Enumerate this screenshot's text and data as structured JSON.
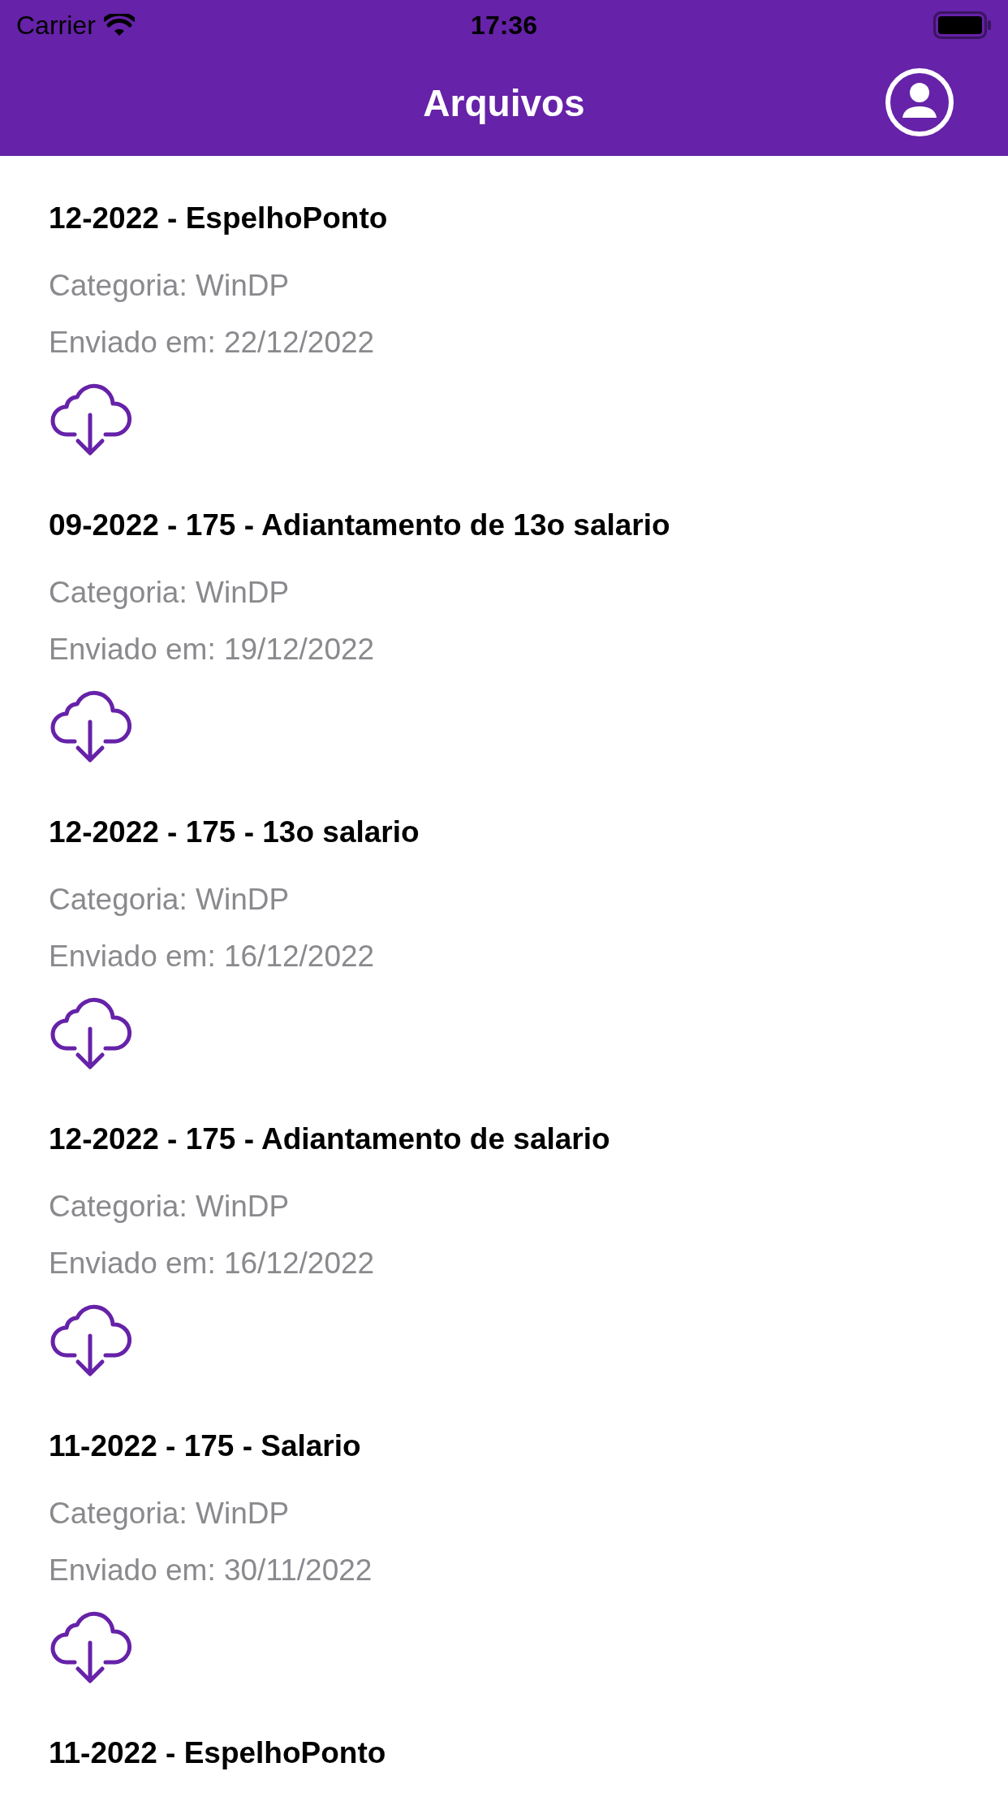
{
  "status_bar": {
    "carrier": "Carrier",
    "time": "17:36"
  },
  "nav_bar": {
    "title": "Arquivos"
  },
  "files": [
    {
      "title": "12-2022 - EspelhoPonto",
      "category": "Categoria: WinDP",
      "sent": "Enviado em: 22/12/2022"
    },
    {
      "title": "09-2022 - 175 - Adiantamento de 13o salario",
      "category": "Categoria: WinDP",
      "sent": "Enviado em: 19/12/2022"
    },
    {
      "title": "12-2022 - 175 - 13o salario",
      "category": "Categoria: WinDP",
      "sent": "Enviado em: 16/12/2022"
    },
    {
      "title": "12-2022 - 175 - Adiantamento de salario",
      "category": "Categoria: WinDP",
      "sent": "Enviado em: 16/12/2022"
    },
    {
      "title": "11-2022 - 175 - Salario",
      "category": "Categoria: WinDP",
      "sent": "Enviado em: 30/11/2022"
    },
    {
      "title": "11-2022 - EspelhoPonto"
    }
  ]
}
